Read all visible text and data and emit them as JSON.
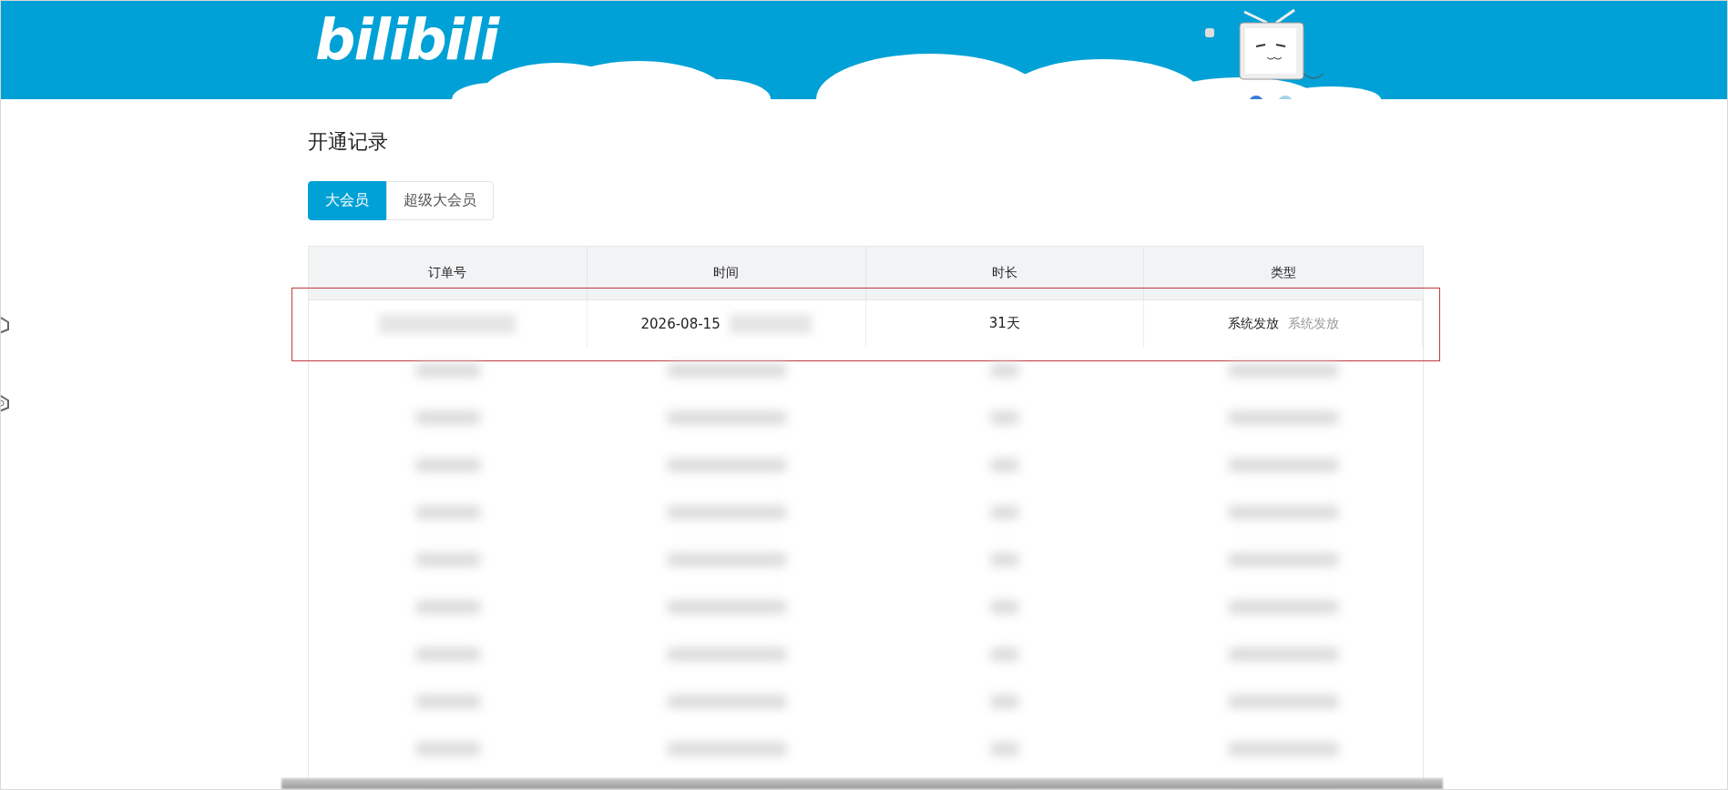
{
  "header": {
    "logo": "bilibili"
  },
  "page_title": "开通记录",
  "tabs": [
    {
      "label": "大会员",
      "selected": true
    },
    {
      "label": "超级大会员",
      "selected": false
    }
  ],
  "table": {
    "columns": [
      "订单号",
      "时间",
      "时长",
      "类型"
    ],
    "rows": [
      {
        "order_hidden": true,
        "date": "2026-08-15",
        "time_hidden": true,
        "duration": "31天",
        "type": "系统发放",
        "type_note": "系统发放",
        "highlighted": true
      }
    ]
  }
}
